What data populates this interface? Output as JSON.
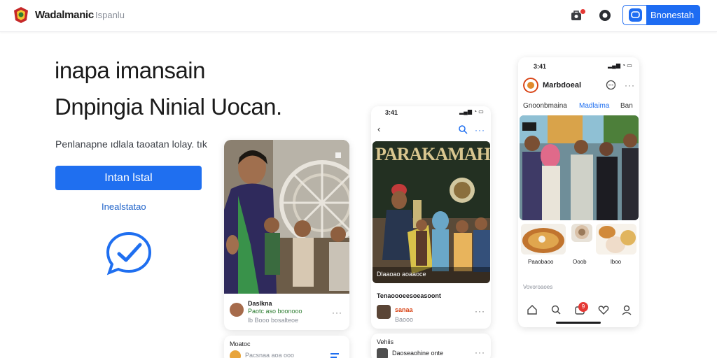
{
  "header": {
    "brand": "Wadalmanic",
    "brand_sub": "Ispanlu",
    "button_label": "Bnonestah"
  },
  "hero": {
    "line1": "inapa imansain",
    "line2": "Dnpingia Ninial Uocan.",
    "subtitle": "Penlanapne ıdlala taoatan lolay. tık",
    "cta_label": "Intan lstal",
    "link_label": "Inealstatao"
  },
  "card1": {
    "user_name": "Daslkna",
    "user_meta": "Paotc aso boonooo",
    "user_meta2": "lb Booo bosalteoe",
    "footer_label": "Moatoc",
    "footer_meta": "Pacsnaa aoa ooo"
  },
  "card2": {
    "time": "3:41",
    "banner_text": "PARAKAMAH",
    "photo_caption": "Dlaaoao aoaaoce",
    "title": "Tenaoooeesoeasoont",
    "user_name": "sanaa",
    "user_meta": "Baooo",
    "footer_label": "Vehiis",
    "footer_meta": "Daoseaohine onte"
  },
  "card3": {
    "time": "3:41",
    "title": "Marbdoeal",
    "tab1": "Gnoonbmaina",
    "tab2": "Madlaima",
    "tab3": "Ban",
    "food_labels": [
      "Paaobaoo",
      "Ooob",
      "lboo"
    ],
    "meta": "Vovoroaoes",
    "badge": "9"
  },
  "colors": {
    "accent": "#1f6ff0",
    "notification": "#e53935"
  },
  "icons": {
    "header": [
      "emblem-logo",
      "notification-icon",
      "location-icon",
      "chat-icon"
    ],
    "hero": "checkmark-chat-icon"
  }
}
